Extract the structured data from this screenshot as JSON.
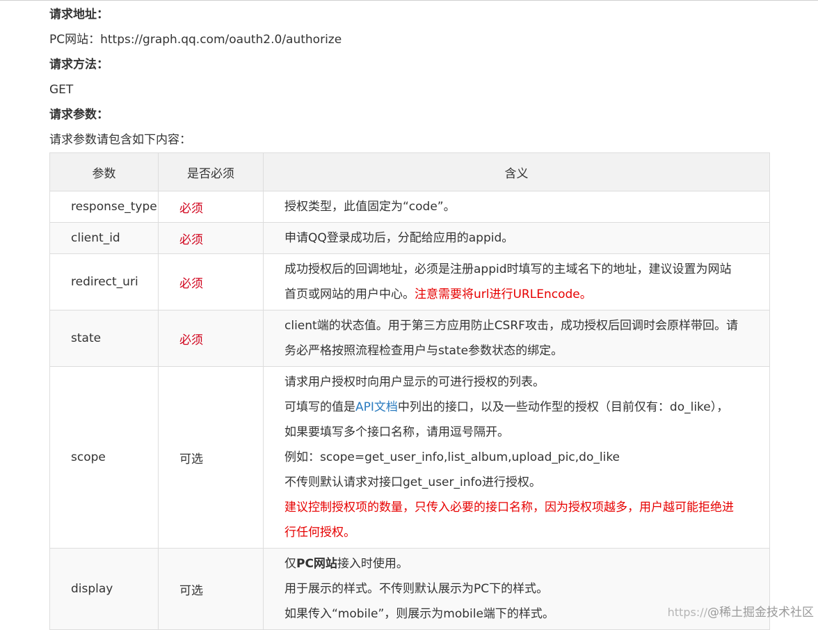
{
  "doc": {
    "request_url_heading": "请求地址：",
    "request_url_value": "PC网站：https://graph.qq.com/oauth2.0/authorize",
    "request_method_heading": "请求方法：",
    "request_method_value": "GET",
    "request_params_heading": "请求参数：",
    "request_params_intro": "请求参数请包含如下内容："
  },
  "table": {
    "headers": [
      "参数",
      "是否必须",
      "含义"
    ],
    "rows": [
      {
        "name": "response_type",
        "required": "必须",
        "desc": [
          "授权类型，此值固定为“code”。"
        ]
      },
      {
        "name": "client_id",
        "required": "必须",
        "desc": [
          "申请QQ登录成功后，分配给应用的appid。"
        ]
      },
      {
        "name": "redirect_uri",
        "required": "必须",
        "desc": [
          "成功授权后的回调地址，必须是注册appid时填写的主域名下的地址，建议设置为网站"
        ],
        "desc_tail": "首页或网站的用户中心。",
        "desc_red": "注意需要将url进行URLEncode。"
      },
      {
        "name": "state",
        "required": "必须",
        "desc": [
          "client端的状态值。用于第三方应用防止CSRF攻击，成功授权后回调时会原样带回。请",
          "务必严格按照流程检查用户与state参数状态的绑定。"
        ]
      },
      {
        "name": "scope",
        "required": "可选",
        "desc": [
          "请求用户授权时向用户显示的可进行授权的列表。"
        ],
        "desc_pre": "可填写的值是",
        "desc_link": "API文档",
        "desc_post": "中列出的接口，以及一些动作型的授权（目前仅有：do_like），",
        "desc_more": [
          "如果要填写多个接口名称，请用逗号隔开。",
          "例如：scope=get_user_info,list_album,upload_pic,do_like",
          "不传则默认请求对接口get_user_info进行授权。"
        ],
        "desc_red": [
          "建议控制授权项的数量，只传入必要的接口名称，因为授权项越多，用户越可能拒绝进",
          "行任何授权。"
        ]
      },
      {
        "name": "display",
        "required": "可选",
        "desc_pre": "仅",
        "desc_strong": "PC网站",
        "desc_post": "接入时使用。",
        "desc": [
          "用于展示的样式。不传则默认展示为PC下的样式。",
          "如果传入“mobile”，则展示为mobile端下的样式。"
        ]
      }
    ]
  },
  "watermark": {
    "url": "https://",
    "brand": "@稀土掘金技术社区"
  },
  "colors": {
    "required_red": "#d0021b",
    "note_red": "#e60000",
    "link_blue": "#2a7bbf",
    "header_bg": "#f2f2f2",
    "border": "#dddddd"
  }
}
